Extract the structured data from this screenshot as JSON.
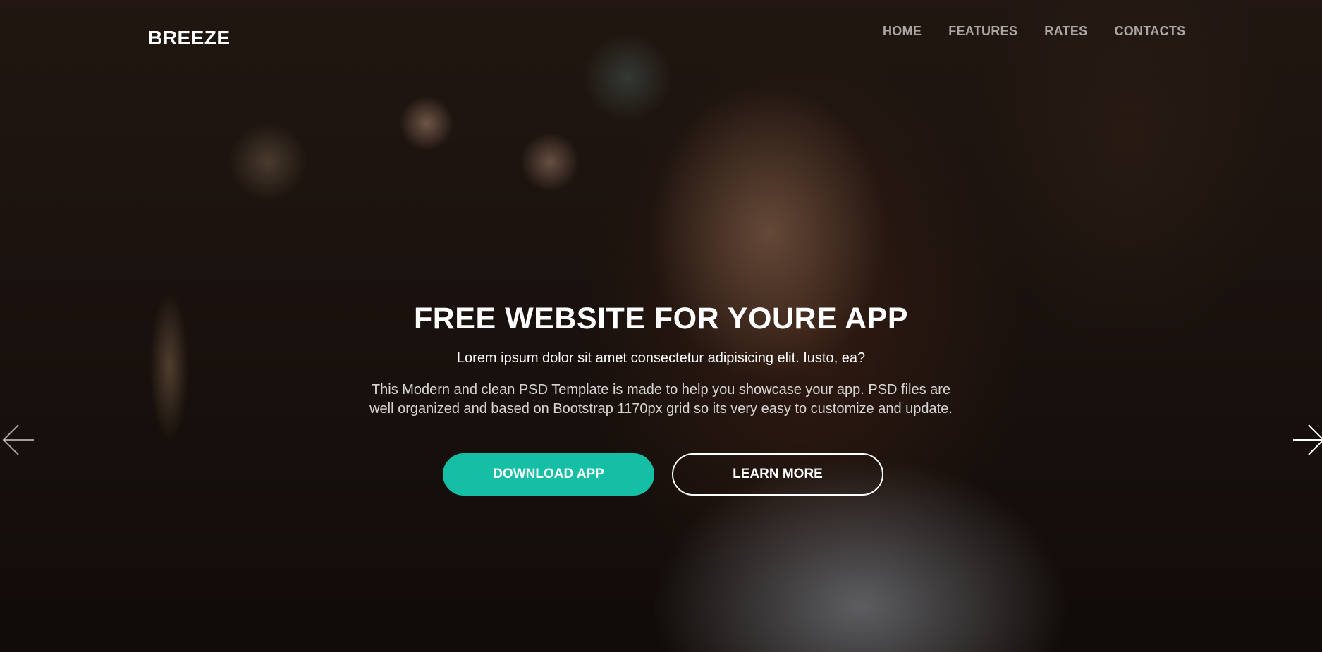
{
  "header": {
    "brand": "BREEZE",
    "nav": [
      {
        "label": "HOME"
      },
      {
        "label": "FEATURES"
      },
      {
        "label": "RATES"
      },
      {
        "label": "CONTACTS"
      }
    ]
  },
  "hero": {
    "title": "FREE WEBSITE FOR YOURE APP",
    "subtitle": "Lorem ipsum dolor sit amet consectetur adipisicing elit. Iusto, ea?",
    "description_line1": "This Modern and clean PSD Template is made to help you showcase your app. PSD files are",
    "description_line2": "well organized and based on Bootstrap 1170px grid so its very easy to customize and update.",
    "primary_button": "DOWNLOAD APP",
    "secondary_button": "LEARN MORE"
  },
  "carousel": {
    "prev_icon": "arrow-left-icon",
    "next_icon": "arrow-right-icon"
  },
  "colors": {
    "accent": "#14bfa6",
    "text": "#ffffff"
  }
}
